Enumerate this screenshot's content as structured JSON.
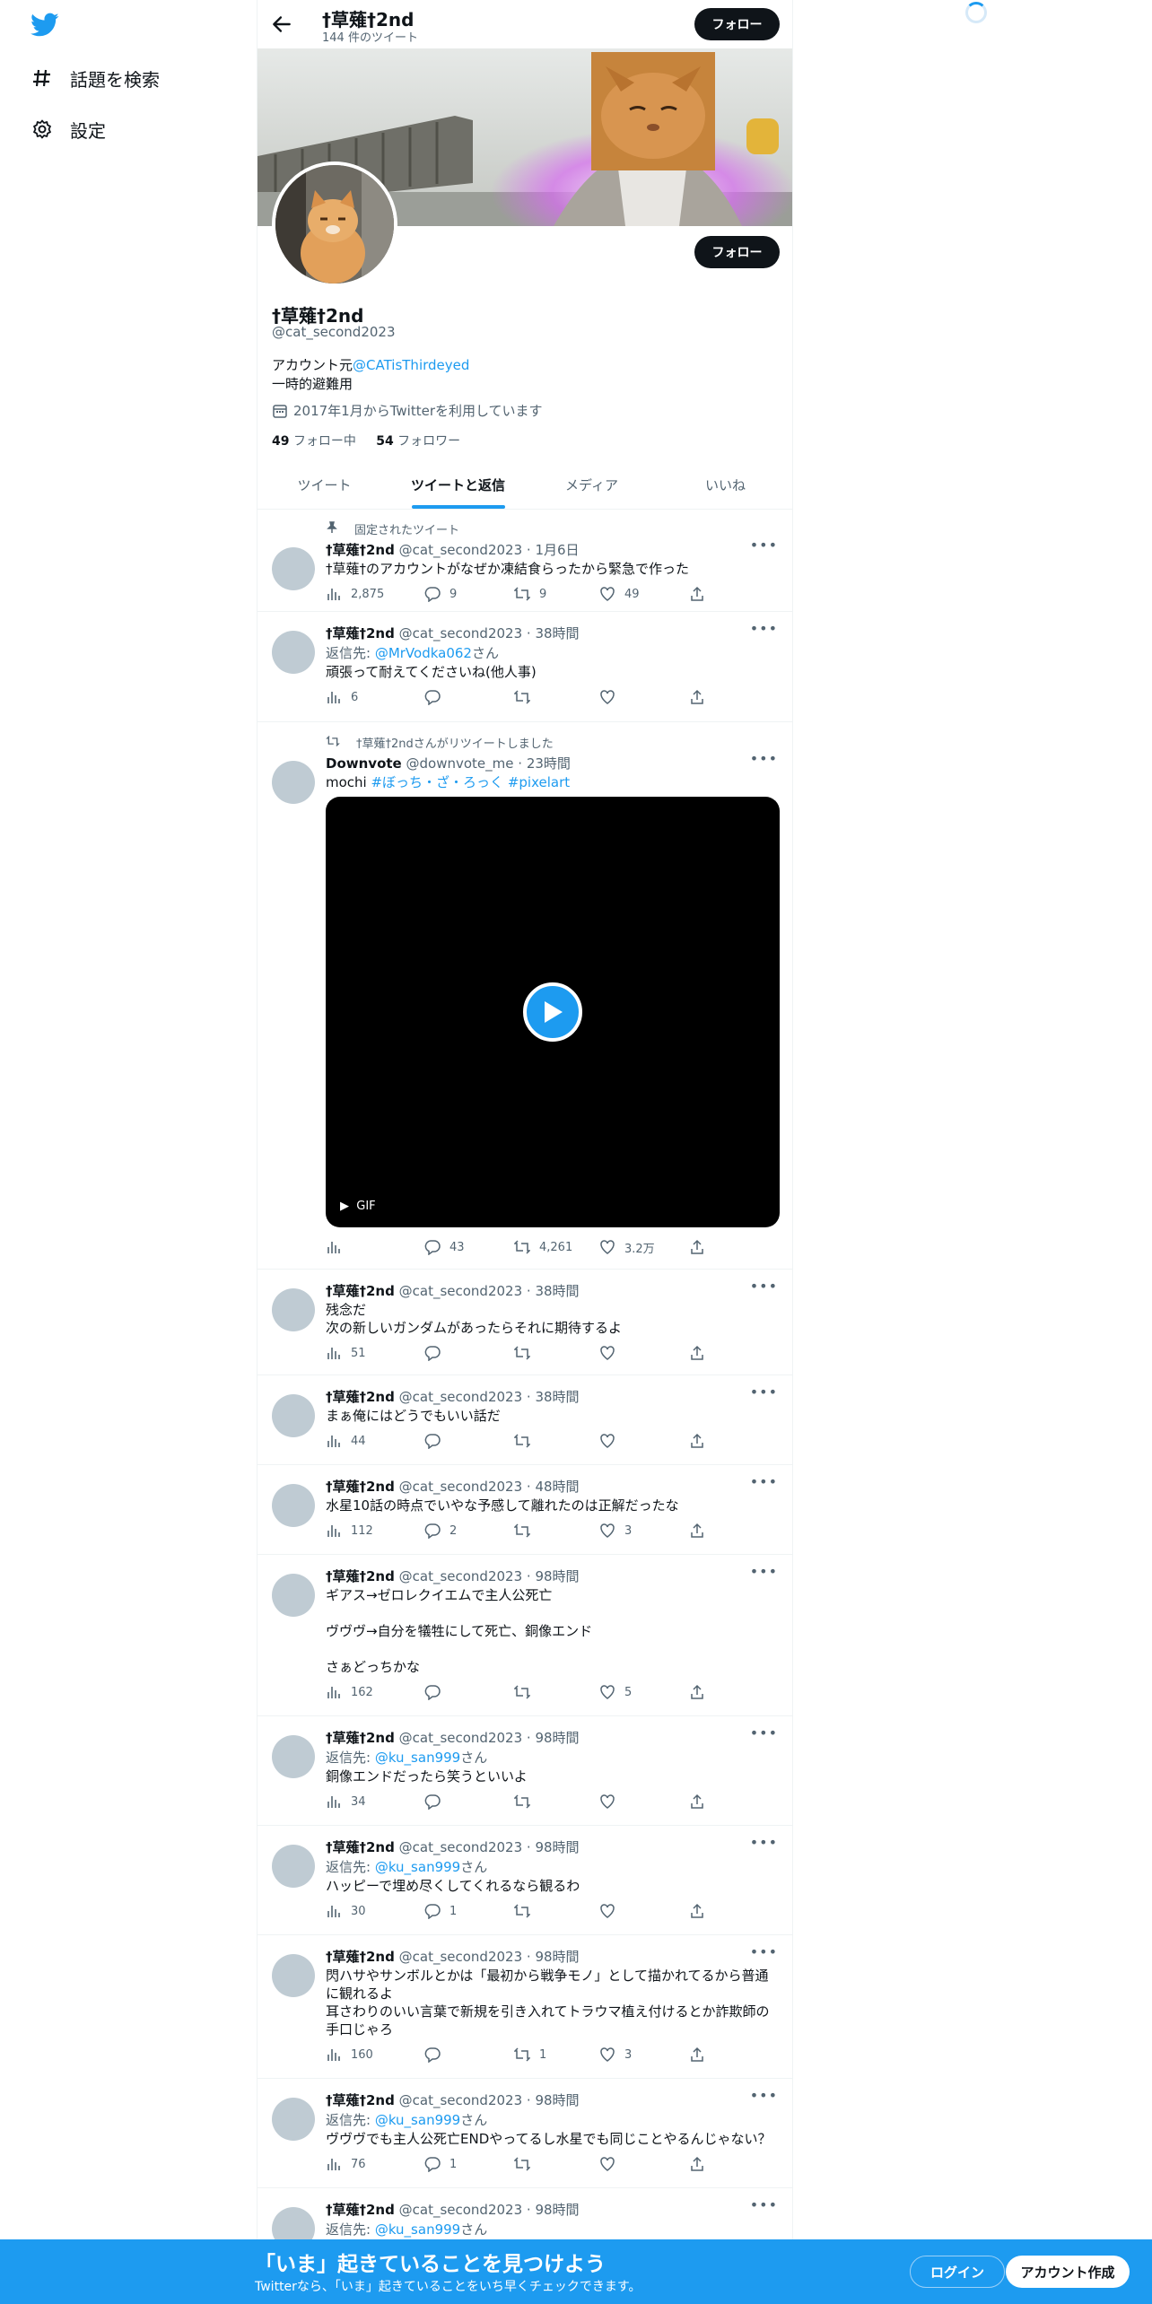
{
  "nav": {
    "explore_label": "話題を検索",
    "settings_label": "設定"
  },
  "header": {
    "name": "†草薙†2nd",
    "tweet_count": "144 件のツイート",
    "follow_label": "フォロー"
  },
  "profile": {
    "name": "†草薙†2nd",
    "handle": "@cat_second2023",
    "bio_prefix": "アカウント元",
    "bio_link": "@CATisThirdeyed",
    "bio_line2": "一時的避難用",
    "joined": "2017年1月からTwitterを利用しています",
    "following_count": "49",
    "following_label": "フォロー中",
    "followers_count": "54",
    "followers_label": "フォロワー",
    "follow_label": "フォロー"
  },
  "tabs": [
    "ツイート",
    "ツイートと返信",
    "メディア",
    "いいね"
  ],
  "tweets": [
    {
      "context": "固定されたツイート",
      "name": "†草薙†2nd",
      "handle": "@cat_second2023",
      "time": "1月6日",
      "text": "†草薙†のアカウントがなぜか凍結食らったから緊急で作った",
      "views": "2,875",
      "replies": "9",
      "retweets": "9",
      "likes": "49"
    },
    {
      "name": "†草薙†2nd",
      "handle": "@cat_second2023",
      "time": "38時間",
      "reply_prefix": "返信先: ",
      "reply_to": "@MrVodka062",
      "reply_suffix": "さん",
      "text": "頑張って耐えてくださいね(他人事)",
      "views": "6",
      "replies": "",
      "retweets": "",
      "likes": ""
    },
    {
      "context": "†草薙†2ndさんがリツイートしました",
      "name": "Downvote",
      "handle": "@downvote_me",
      "time": "23時間",
      "text_plain": "mochi ",
      "text_tags": "#ぼっち・ざ・ろっく #pixelart",
      "gif_label": "GIF",
      "views": "",
      "replies": "43",
      "retweets": "4,261",
      "likes": "3.2万"
    },
    {
      "name": "†草薙†2nd",
      "handle": "@cat_second2023",
      "time": "38時間",
      "text": "残念だ\n次の新しいガンダムがあったらそれに期待するよ",
      "views": "51",
      "replies": "",
      "retweets": "",
      "likes": ""
    },
    {
      "name": "†草薙†2nd",
      "handle": "@cat_second2023",
      "time": "38時間",
      "text": "まぁ俺にはどうでもいい話だ",
      "views": "44",
      "replies": "",
      "retweets": "",
      "likes": ""
    },
    {
      "name": "†草薙†2nd",
      "handle": "@cat_second2023",
      "time": "48時間",
      "text": "水星10話の時点でいやな予感して離れたのは正解だったな",
      "views": "112",
      "replies": "2",
      "retweets": "",
      "likes": "3"
    },
    {
      "name": "†草薙†2nd",
      "handle": "@cat_second2023",
      "time": "98時間",
      "text": "ギアス→ゼロレクイエムで主人公死亡\n\nヴヴヴ→自分を犠牲にして死亡、銅像エンド\n\nさぁどっちかな",
      "views": "162",
      "replies": "",
      "retweets": "",
      "likes": "5"
    },
    {
      "name": "†草薙†2nd",
      "handle": "@cat_second2023",
      "time": "98時間",
      "reply_prefix": "返信先: ",
      "reply_to": "@ku_san999",
      "reply_suffix": "さん",
      "text": "銅像エンドだったら笑うといいよ",
      "views": "34",
      "replies": "",
      "retweets": "",
      "likes": ""
    },
    {
      "name": "†草薙†2nd",
      "handle": "@cat_second2023",
      "time": "98時間",
      "reply_prefix": "返信先: ",
      "reply_to": "@ku_san999",
      "reply_suffix": "さん",
      "text": "ハッピーで埋め尽くしてくれるなら観るわ",
      "views": "30",
      "replies": "1",
      "retweets": "",
      "likes": ""
    },
    {
      "name": "†草薙†2nd",
      "handle": "@cat_second2023",
      "time": "98時間",
      "text": "閃ハサやサンボルとかは「最初から戦争モノ」として描かれてるから普通に観れるよ\n耳さわりのいい言葉で新規を引き入れてトラウマ植え付けるとか詐欺師の手口じゃろ",
      "views": "160",
      "replies": "",
      "retweets": "1",
      "likes": "3"
    },
    {
      "name": "†草薙†2nd",
      "handle": "@cat_second2023",
      "time": "98時間",
      "reply_prefix": "返信先: ",
      "reply_to": "@ku_san999",
      "reply_suffix": "さん",
      "text": "ヴヴヴでも主人公死亡ENDやってるし水星でも同じことやるんじゃない？",
      "views": "76",
      "replies": "1",
      "retweets": "",
      "likes": ""
    },
    {
      "name": "†草薙†2nd",
      "handle": "@cat_second2023",
      "time": "98時間",
      "reply_prefix": "返信先: ",
      "reply_to": "@ku_san999",
      "reply_suffix": "さん"
    }
  ],
  "bottom_bar": {
    "title": "「いま」起きていることを見つけよう",
    "subtitle": "Twitterなら、「いま」起きていることをいち早くチェックできます。",
    "login_label": "ログイン",
    "signup_label": "アカウント作成"
  },
  "colors": {
    "accent": "#1d9bf0",
    "text": "#0f1419",
    "muted": "#536471"
  }
}
